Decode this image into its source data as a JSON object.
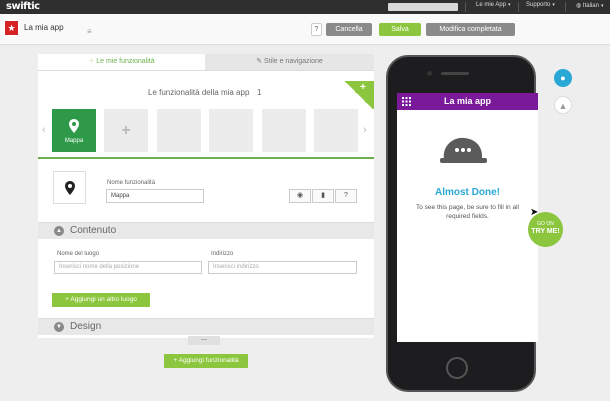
{
  "topbar": {
    "logo": "swiftic",
    "apps_label": "Le mie App",
    "support_label": "Supporto",
    "language_label": "Italian"
  },
  "header": {
    "app_name": "La mia app",
    "help_label": "?",
    "cancel_label": "Cancella",
    "save_label": "Salva",
    "edit_done_label": "Modifica completata"
  },
  "tabs": [
    {
      "label": "Le mie funzionalità",
      "icon": "grid-icon"
    },
    {
      "label": "Stile e navigazione",
      "icon": "brush-icon"
    }
  ],
  "features": {
    "title": "Le funzionalità della mia app",
    "count": "1",
    "items": [
      {
        "label": "Mappa",
        "icon": "map-pin-icon"
      }
    ],
    "add_symbol": "+",
    "corner_symbol": "+",
    "nav_left": "‹",
    "nav_right": "›"
  },
  "feature_detail": {
    "name_label": "Nome funzionalità",
    "name_value": "Mappa",
    "actions": [
      "eye-icon",
      "trash-icon",
      "?"
    ]
  },
  "content": {
    "section_title": "Contenuto",
    "place_label": "Nome del luogo",
    "place_placeholder": "Inserisci nome della posizione",
    "address_label": "Indirizzo",
    "address_placeholder": "Inserisci indirizzo",
    "add_place_label": "+ Aggiungi un altro luogo"
  },
  "design": {
    "section_title": "Design",
    "collapse_label": "—"
  },
  "add_feature_label": "+ Aggiungi funzionalità",
  "preview": {
    "app_title": "La mia app",
    "headline": "Almost Done!",
    "message": "To see this page, be sure to fill in all required fields.",
    "try_small": "GO ON",
    "try_big": "TRY ME!"
  },
  "colors": {
    "accent_green": "#8cc63f",
    "feature_green": "#2e9a49",
    "app_header_purple": "#7a1a9a",
    "headline_blue": "#29a8d6"
  }
}
